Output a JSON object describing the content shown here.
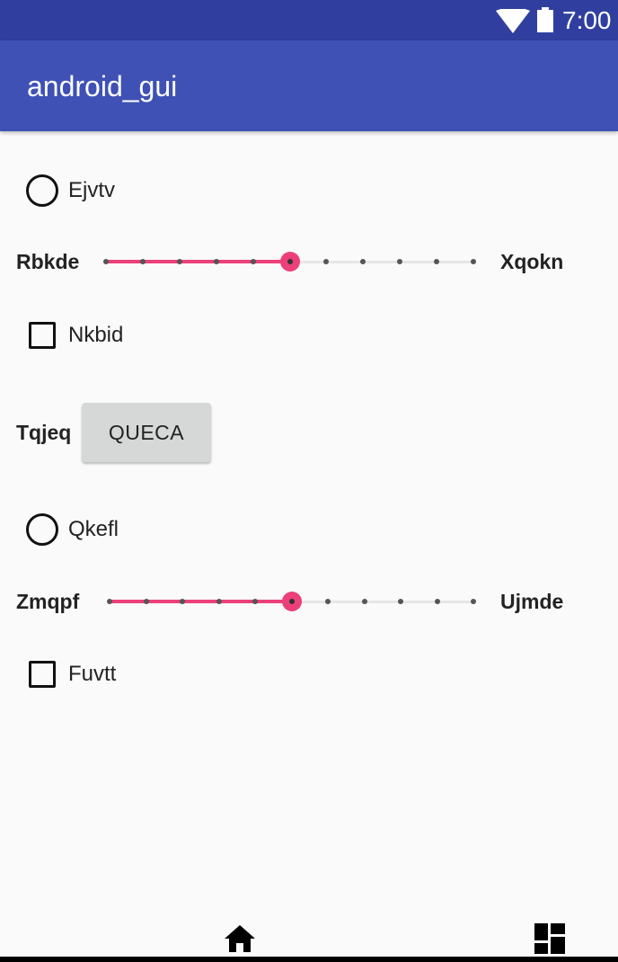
{
  "status_bar": {
    "time": "7:00",
    "wifi_icon": "wifi-icon",
    "battery_icon": "battery-icon"
  },
  "app_bar": {
    "title": "android_gui"
  },
  "radio_1": {
    "label": "Ejvtv",
    "checked": false
  },
  "slider_1": {
    "left_label": "Rbkde",
    "right_label": "Xqokn",
    "steps": 10,
    "value": 5
  },
  "checkbox_1": {
    "label": "Nkbid",
    "checked": false
  },
  "button_row": {
    "label": "Tqjeq",
    "button_text": "QUECA"
  },
  "radio_2": {
    "label": "Qkefl",
    "checked": false
  },
  "slider_2": {
    "left_label": "Zmqpf",
    "right_label": "Ujmde",
    "steps": 10,
    "value": 5
  },
  "checkbox_2": {
    "label": "Fuvtt",
    "checked": false
  },
  "nav_bar": {
    "home_icon": "home-icon",
    "recents_icon": "recents-icon"
  },
  "colors": {
    "status_bar": "#303f9f",
    "app_bar": "#3f51b5",
    "accent": "#ec407a",
    "background": "#fafafa"
  }
}
